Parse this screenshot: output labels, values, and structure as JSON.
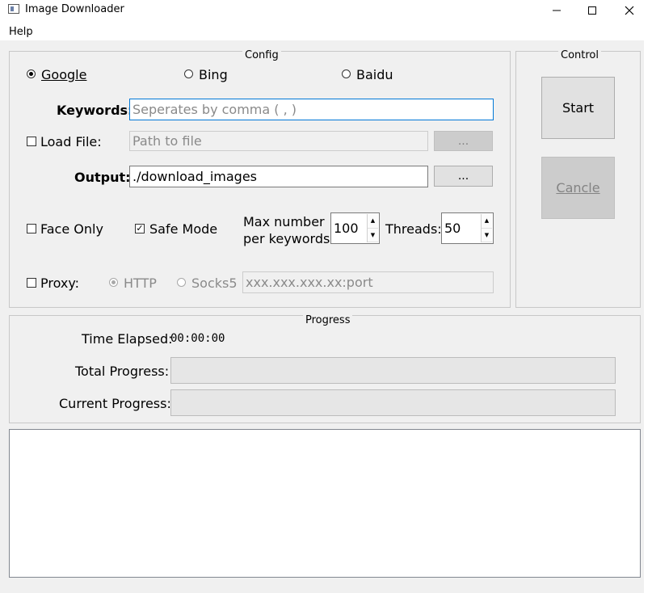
{
  "window": {
    "title": "Image Downloader",
    "minimize_icon": "minimize-icon",
    "maximize_icon": "maximize-icon",
    "close_icon": "close-icon"
  },
  "menu": {
    "help": "Help"
  },
  "config": {
    "title": "Config",
    "engines": [
      {
        "name": "Google",
        "checked": true
      },
      {
        "name": "Bing",
        "checked": false
      },
      {
        "name": "Baidu",
        "checked": false
      }
    ],
    "keywords": {
      "label": "Keywords:",
      "placeholder": "Seperates by comma ( , )",
      "value": ""
    },
    "load_file": {
      "label": "Load File:",
      "checked": false,
      "placeholder": "Path to file",
      "browse_label": "..."
    },
    "output": {
      "label": "Output:",
      "value": "./download_images",
      "browse_label": "..."
    },
    "face_only": {
      "label": "Face Only",
      "checked": false
    },
    "safe_mode": {
      "label": "Safe Mode",
      "checked": true
    },
    "max_number": {
      "label_line1": "Max number",
      "label_line2": "per keywords",
      "value": "100"
    },
    "threads": {
      "label": "Threads:",
      "value": "50"
    },
    "proxy": {
      "label": "Proxy:",
      "checked": false,
      "types": [
        {
          "name": "HTTP",
          "checked": true
        },
        {
          "name": "Socks5",
          "checked": false
        }
      ],
      "placeholder": "xxx.xxx.xxx.xx:port"
    }
  },
  "control": {
    "title": "Control",
    "start_label": "Start",
    "cancel_label": "Cancle"
  },
  "progress": {
    "title": "Progress",
    "time_elapsed_label": "Time Elapsed:",
    "time_elapsed_value": "00:00:00",
    "total_label": "Total Progress:",
    "total_value": 0,
    "current_label": "Current Progress:",
    "current_value": 0
  },
  "log": {
    "text": ""
  },
  "colors": {
    "accent": "#0078d7",
    "window_bg": "#f0f0f0"
  }
}
